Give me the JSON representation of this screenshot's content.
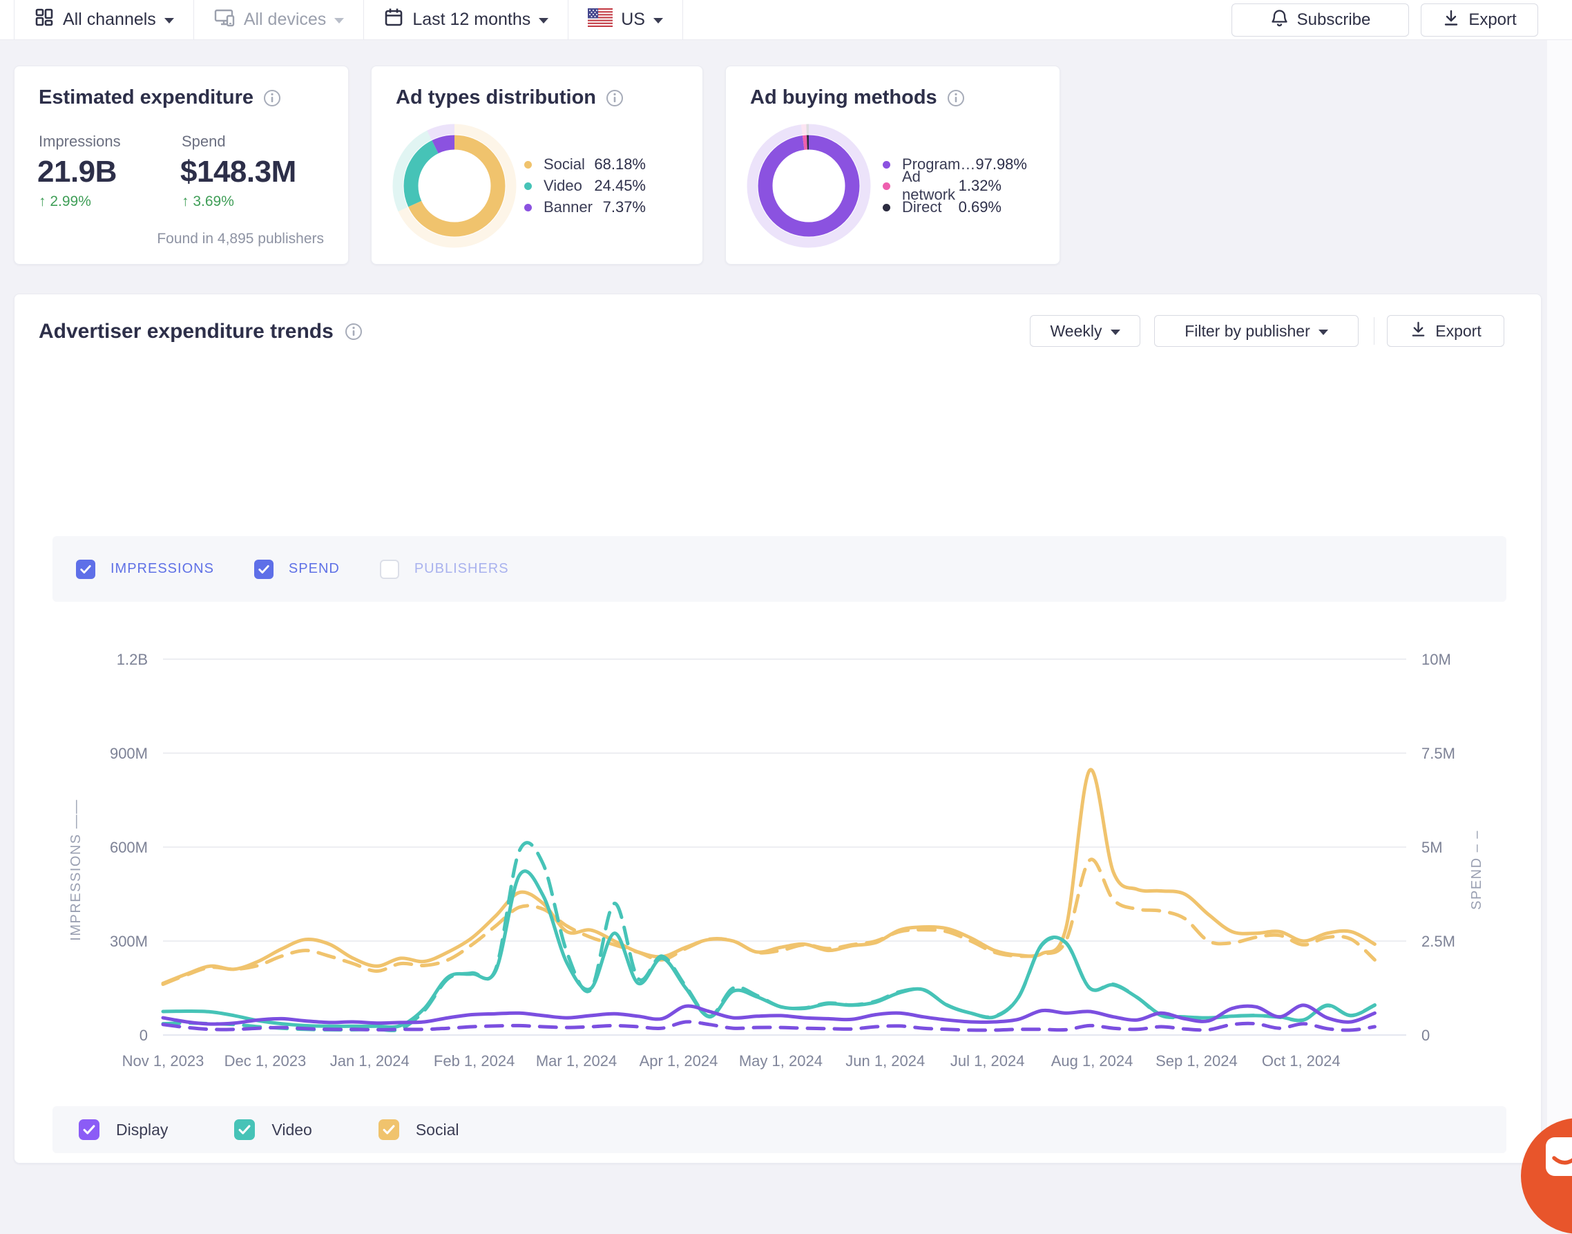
{
  "toolbar": {
    "filters": [
      {
        "label": "All channels",
        "icon": "channels-icon",
        "disabled": false
      },
      {
        "label": "All devices",
        "icon": "devices-icon",
        "disabled": true
      },
      {
        "label": "Last 12 months",
        "icon": "calendar-icon",
        "disabled": false
      },
      {
        "label": "US",
        "icon": "us-flag-icon",
        "disabled": false
      }
    ],
    "subscribe_label": "Subscribe",
    "export_label": "Export"
  },
  "colors": {
    "social": "#f0c36d",
    "video": "#46c3b7",
    "display": "#7b4fe0",
    "programmatic": "#8b52e0",
    "ad_network": "#ee5fae",
    "direct": "#2c2c40",
    "positive_change": "#3f9e57",
    "checkbox_blue": "#5e6fe8"
  },
  "cards": {
    "estimated_expenditure": {
      "title": "Estimated expenditure",
      "impressions_label": "Impressions",
      "impressions_value": "21.9B",
      "impressions_change": "2.99%",
      "spend_label": "Spend",
      "spend_value": "$148.3M",
      "spend_change": "3.69%",
      "footnote": "Found in 4,895 publishers"
    },
    "ad_types": {
      "title": "Ad types distribution",
      "legend": [
        {
          "label": "Social",
          "value": "68.18%",
          "pct": 68.18,
          "color": "#f0c36d"
        },
        {
          "label": "Video",
          "value": "24.45%",
          "pct": 24.45,
          "color": "#46c3b7"
        },
        {
          "label": "Banner",
          "value": "7.37%",
          "pct": 7.37,
          "color": "#8b52e0"
        }
      ]
    },
    "ad_buying": {
      "title": "Ad buying methods",
      "legend": [
        {
          "label": "Program…",
          "value": "97.98%",
          "pct": 97.98,
          "color": "#8b52e0"
        },
        {
          "label": "Ad network",
          "value": "1.32%",
          "pct": 1.32,
          "color": "#ee5fae"
        },
        {
          "label": "Direct",
          "value": "0.69%",
          "pct": 0.69,
          "color": "#2c2c40"
        }
      ]
    }
  },
  "trends": {
    "title": "Advertiser expenditure trends",
    "weekly_label": "Weekly",
    "filter_label": "Filter by publisher",
    "export_label": "Export",
    "metric_toggles": [
      {
        "label": "IMPRESSIONS",
        "checked": true
      },
      {
        "label": "SPEND",
        "checked": true
      },
      {
        "label": "PUBLISHERS",
        "checked": false
      }
    ],
    "series_toggles": [
      {
        "label": "Display",
        "color": "#8b5cf6",
        "checked": true
      },
      {
        "label": "Video",
        "color": "#46c3b7",
        "checked": true
      },
      {
        "label": "Social",
        "color": "#f0c36d",
        "checked": true
      }
    ]
  },
  "chart_data": {
    "type": "line",
    "x_labels": [
      "Nov 1, 2023",
      "Dec 1, 2023",
      "Jan 1, 2024",
      "Feb 1, 2024",
      "Mar 1, 2024",
      "Apr 1, 2024",
      "May 1, 2024",
      "Jun 1, 2024",
      "Jul 1, 2024",
      "Aug 1, 2024",
      "Sep 1, 2024",
      "Oct 1, 2024"
    ],
    "x_unit": "week",
    "left_axis": {
      "label": "IMPRESSIONS",
      "ticks": [
        "0",
        "300M",
        "600M",
        "900M",
        "1.2B"
      ],
      "range_millions": [
        0,
        1200
      ]
    },
    "right_axis": {
      "label": "SPEND",
      "ticks": [
        "0",
        "2.5M",
        "5M",
        "7.5M",
        "10M"
      ],
      "range_millions_usd": [
        0,
        10
      ]
    },
    "grid": true,
    "legend_position": "bottom",
    "series": [
      {
        "name": "Social impressions",
        "axis": "left",
        "style": "solid",
        "color": "#f0c36d",
        "unit": "M impressions",
        "values": [
          165,
          195,
          220,
          210,
          235,
          275,
          305,
          290,
          245,
          220,
          245,
          235,
          265,
          310,
          380,
          455,
          420,
          330,
          335,
          300,
          265,
          250,
          280,
          305,
          300,
          265,
          280,
          290,
          270,
          285,
          295,
          335,
          345,
          340,
          310,
          270,
          255,
          260,
          340,
          845,
          520,
          465,
          460,
          450,
          385,
          330,
          325,
          330,
          300,
          325,
          330,
          290
        ]
      },
      {
        "name": "Social spend",
        "axis": "right",
        "style": "dashed",
        "color": "#f0c36d",
        "unit": "M USD",
        "values": [
          1.35,
          1.6,
          1.8,
          1.75,
          1.85,
          2.1,
          2.25,
          2.1,
          1.9,
          1.7,
          1.9,
          1.85,
          2.0,
          2.4,
          2.9,
          3.4,
          3.35,
          2.9,
          2.6,
          2.4,
          2.2,
          2.0,
          2.3,
          2.55,
          2.5,
          2.2,
          2.25,
          2.4,
          2.3,
          2.4,
          2.5,
          2.75,
          2.8,
          2.75,
          2.5,
          2.2,
          2.1,
          2.15,
          2.5,
          4.65,
          3.6,
          3.35,
          3.3,
          3.1,
          2.5,
          2.45,
          2.6,
          2.65,
          2.4,
          2.6,
          2.55,
          2.0
        ]
      },
      {
        "name": "Video impressions",
        "axis": "left",
        "style": "solid",
        "color": "#46c3b7",
        "unit": "M impressions",
        "values": [
          75,
          76,
          74,
          62,
          46,
          36,
          30,
          28,
          28,
          28,
          30,
          85,
          185,
          195,
          205,
          510,
          445,
          230,
          148,
          325,
          165,
          245,
          150,
          58,
          140,
          122,
          90,
          85,
          100,
          95,
          105,
          135,
          145,
          95,
          70,
          58,
          120,
          290,
          295,
          150,
          160,
          120,
          65,
          58,
          55,
          60,
          62,
          58,
          48,
          95,
          62,
          95
        ]
      },
      {
        "name": "Video spend",
        "axis": "right",
        "style": "dashed",
        "color": "#46c3b7",
        "unit": "M USD",
        "values": [
          0.3,
          0.32,
          0.3,
          0.28,
          0.22,
          0.18,
          0.15,
          0.14,
          0.14,
          0.15,
          0.16,
          0.65,
          1.5,
          1.65,
          1.75,
          4.9,
          4.55,
          2.2,
          1.2,
          3.5,
          1.5,
          2.1,
          1.3,
          0.5,
          1.25,
          1.05,
          0.75,
          0.72,
          0.85,
          0.8,
          0.9,
          1.15,
          1.2,
          0.8,
          0.58,
          0.5,
          1.0,
          2.4,
          2.45,
          1.25,
          1.35,
          1.0,
          0.52,
          0.47,
          0.45,
          0.5,
          0.52,
          0.47,
          0.4,
          0.78,
          0.52,
          0.8
        ]
      },
      {
        "name": "Display impressions",
        "axis": "left",
        "style": "solid",
        "color": "#7b4fe0",
        "unit": "M impressions",
        "values": [
          55,
          42,
          35,
          38,
          48,
          52,
          45,
          40,
          42,
          38,
          40,
          42,
          55,
          65,
          68,
          70,
          62,
          55,
          62,
          68,
          60,
          52,
          92,
          75,
          55,
          60,
          62,
          55,
          52,
          50,
          65,
          70,
          58,
          48,
          42,
          42,
          50,
          78,
          70,
          75,
          58,
          48,
          70,
          52,
          45,
          85,
          90,
          58,
          95,
          55,
          42,
          70
        ]
      },
      {
        "name": "Display spend",
        "axis": "right",
        "style": "dashed",
        "color": "#7b4fe0",
        "unit": "M USD",
        "values": [
          0.28,
          0.2,
          0.15,
          0.15,
          0.18,
          0.2,
          0.17,
          0.15,
          0.15,
          0.14,
          0.15,
          0.15,
          0.18,
          0.22,
          0.24,
          0.25,
          0.22,
          0.2,
          0.22,
          0.25,
          0.22,
          0.18,
          0.35,
          0.28,
          0.18,
          0.2,
          0.2,
          0.18,
          0.17,
          0.16,
          0.22,
          0.24,
          0.18,
          0.15,
          0.13,
          0.13,
          0.15,
          0.15,
          0.14,
          0.25,
          0.18,
          0.15,
          0.22,
          0.16,
          0.14,
          0.28,
          0.3,
          0.18,
          0.3,
          0.17,
          0.13,
          0.22
        ]
      }
    ]
  }
}
